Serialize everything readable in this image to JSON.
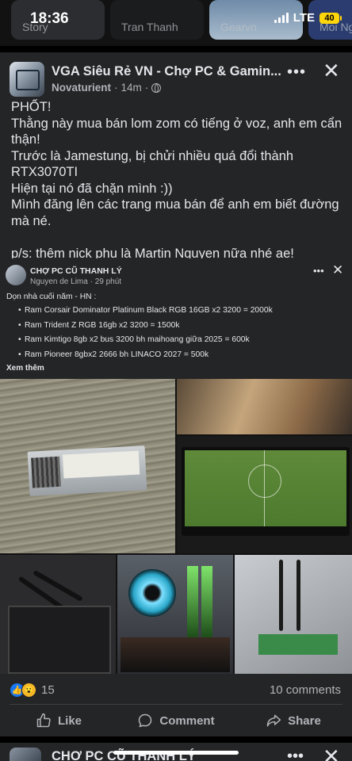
{
  "status_bar": {
    "time": "18:36",
    "network": "LTE",
    "battery": "40"
  },
  "stories": [
    "Story",
    "Tran Thanh",
    "Gearvn",
    "Moi Nga"
  ],
  "post": {
    "group_name": "VGA Siêu Rẻ VN - Chợ PC & Gamin...",
    "author": "Novaturient",
    "time": "14m",
    "text_lines": [
      "PHỐT!",
      "Thằng này mua bán lom zom có tiếng ở voz, anh em cẩn thận!",
      "Trước là Jamestung, bị chửi nhiều quá đổi thành RTX3070TI",
      "Hiện tại nó đã chặn mình :))",
      "Mình đăng lên các trang mua bán để anh em biết đường mà né."
    ],
    "ps_line": "p/s: thêm nick phụ là Martin Nguyen nữa nhé ae!"
  },
  "shared_post": {
    "group_name": "CHỢ PC CŨ THANH LÝ",
    "author": "Nguyen de Lima",
    "time": "29 phút",
    "intro": "Dọn nhà cuối năm - HN :",
    "items": [
      "Ram Corsair Dominator Platinum Black RGB 16GB x2 3200 = 2000k",
      "Ram Trident Z RGB 16gb x2 3200 = 1500k",
      "Ram Kimtigo 8gb x2 bus 3200 bh maihoang giữa 2025 = 600k",
      "Ram Pioneer 8gbx2 2666 bh LINACO 2027 = 500k"
    ],
    "see_more": "Xem thêm"
  },
  "engagement": {
    "reaction_count": "15",
    "comments": "10 comments"
  },
  "actions": {
    "like": "Like",
    "comment": "Comment",
    "share": "Share"
  },
  "next_post": {
    "group_name": "CHỢ PC CŨ THANH LÝ"
  },
  "colors": {
    "card": "#242526",
    "text": "#e4e6eb",
    "muted": "#b0b3b8",
    "like_blue": "#1877f2"
  }
}
